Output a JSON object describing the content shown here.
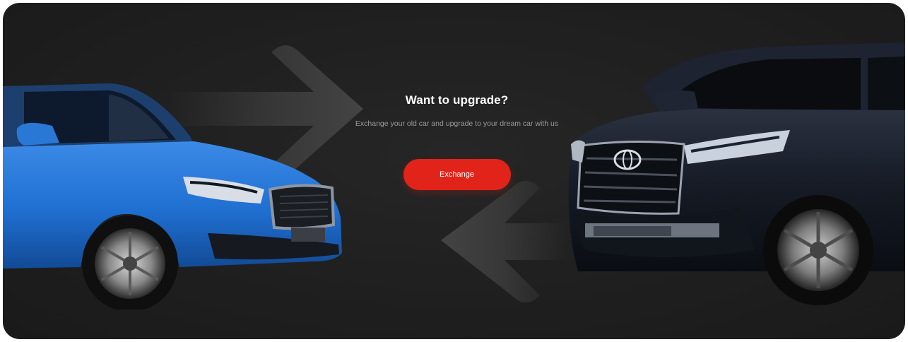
{
  "banner": {
    "title": "Want to upgrade?",
    "subtitle": "Exchange your old car and upgrade to your dream car with us",
    "button_label": "Exchange"
  },
  "colors": {
    "background": "#1f1f1f",
    "accent": "#e2231a",
    "left_car": "#1f6fd1",
    "right_car": "#12161f"
  },
  "images": {
    "left_car": "blue-hatchback-car",
    "right_car": "black-suv-car"
  }
}
